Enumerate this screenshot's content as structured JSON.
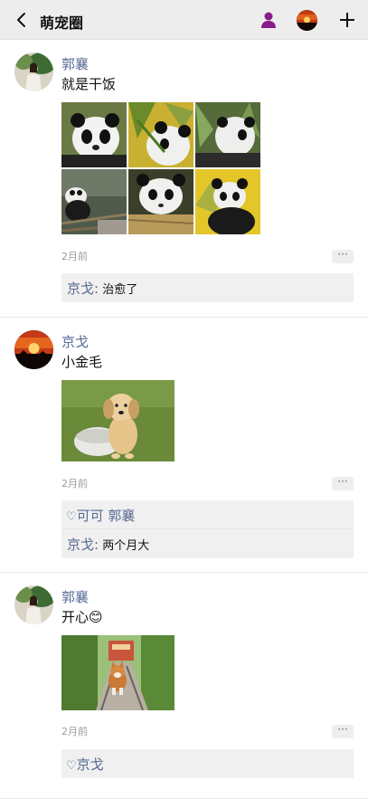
{
  "header": {
    "title": "萌宠圈",
    "back_icon": "chevron-left-icon",
    "person_icon": "person-icon",
    "plus_icon": "plus-icon"
  },
  "colors": {
    "link": "#576b95",
    "person_icon": "#8b1a8b",
    "header_bg": "#ededed"
  },
  "posts": [
    {
      "author": "郭襄",
      "text": "就是干饭",
      "time": "2月前",
      "more": "···",
      "images": [
        "panda-photo-1",
        "panda-photo-2",
        "panda-photo-3",
        "panda-photo-4",
        "panda-photo-5",
        "panda-photo-6"
      ],
      "comments": [
        {
          "name": "京戈:",
          "text": "治愈了"
        }
      ]
    },
    {
      "author": "京戈",
      "text": "小金毛",
      "time": "2月前",
      "more": "···",
      "images": [
        "golden-puppy-photo"
      ],
      "likes": "可可 郭襄",
      "comments": [
        {
          "name": "京戈:",
          "text": "两个月大"
        }
      ]
    },
    {
      "author": "郭襄",
      "text": "开心😊",
      "time": "2月前",
      "more": "···",
      "images": [
        "corgi-rail-photo"
      ],
      "likes": "京戈"
    }
  ]
}
